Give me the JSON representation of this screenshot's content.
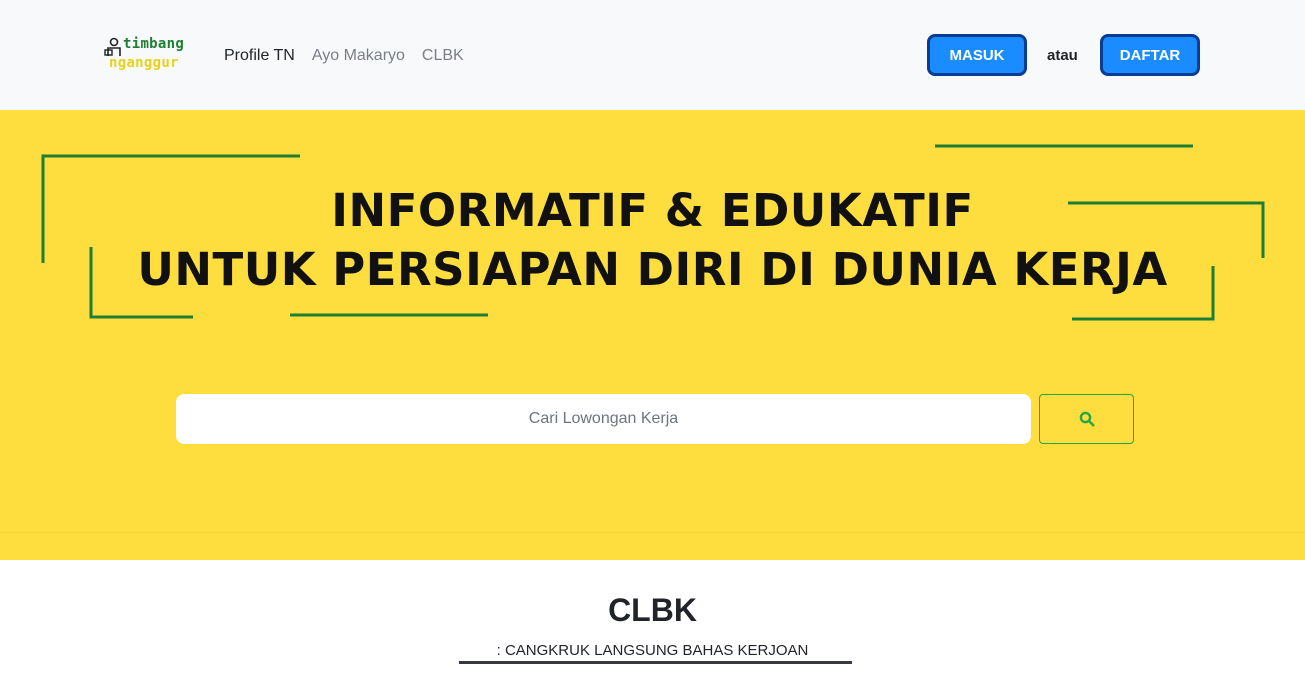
{
  "brand": {
    "line1": "timbang",
    "line2": "nganggur",
    "colors": {
      "line1": "#1e7e34",
      "line2": "#e8d21a"
    }
  },
  "nav": {
    "links": [
      {
        "label": "Profile TN",
        "active": true
      },
      {
        "label": "Ayo Makaryo",
        "active": false
      },
      {
        "label": "CLBK",
        "active": false
      }
    ]
  },
  "auth": {
    "login_label": "MASUK",
    "separator": "atau",
    "register_label": "DAFTAR",
    "button_color": "#1a8cff",
    "button_border_color": "#0a3d91"
  },
  "hero": {
    "background": "#fedd3e",
    "headline_line1": "INFORMATIF & EDUKATIF",
    "headline_line2": "UNTUK PERSIAPAN DIRI DI DUNIA KERJA",
    "frame_color": "#1e7e34",
    "search": {
      "placeholder": "Cari Lowongan Kerja",
      "value": "",
      "button_icon": "search-icon"
    }
  },
  "section": {
    "title": "CLBK",
    "subtitle": ": CANGKRUK LANGSUNG BAHAS KERJOAN"
  }
}
